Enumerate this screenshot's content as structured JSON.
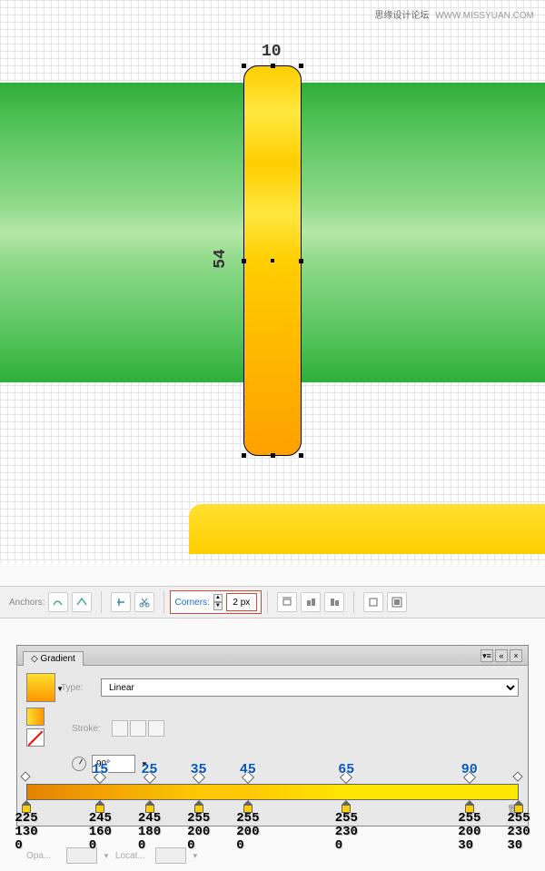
{
  "watermark": {
    "cn": "思缘设计论坛",
    "url": "WWW.MISSYUAN.COM"
  },
  "canvas": {
    "width_label": "10",
    "height_label": "54"
  },
  "toolbar": {
    "anchors_label": "Anchors:",
    "corners_label": "Corners:",
    "corners_value": "2 px"
  },
  "gradient_panel": {
    "title": "Gradient",
    "type_label": "Type:",
    "type_value": "Linear",
    "stroke_label": "Stroke:",
    "angle_value": "90°",
    "opacity_label": "Opa...",
    "location_label": "Locat..."
  },
  "gradient_stops_top": [
    {
      "pos": 15,
      "label": "15"
    },
    {
      "pos": 25,
      "label": "25"
    },
    {
      "pos": 35,
      "label": "35"
    },
    {
      "pos": 45,
      "label": "45"
    },
    {
      "pos": 65,
      "label": "65"
    },
    {
      "pos": 90,
      "label": "90"
    }
  ],
  "gradient_stops_bottom_positions": [
    0,
    15,
    25,
    35,
    45,
    65,
    90,
    100
  ],
  "gradient_rgb": [
    {
      "pos": 0,
      "r": "225",
      "g": "130",
      "b": "0"
    },
    {
      "pos": 15,
      "r": "245",
      "g": "160",
      "b": "0"
    },
    {
      "pos": 25,
      "r": "245",
      "g": "180",
      "b": "0"
    },
    {
      "pos": 35,
      "r": "255",
      "g": "200",
      "b": "0"
    },
    {
      "pos": 45,
      "r": "255",
      "g": "200",
      "b": "0"
    },
    {
      "pos": 65,
      "r": "255",
      "g": "230",
      "b": "0"
    },
    {
      "pos": 90,
      "r": "255",
      "g": "200",
      "b": "30"
    },
    {
      "pos": 100,
      "r": "255",
      "g": "230",
      "b": "30"
    }
  ]
}
